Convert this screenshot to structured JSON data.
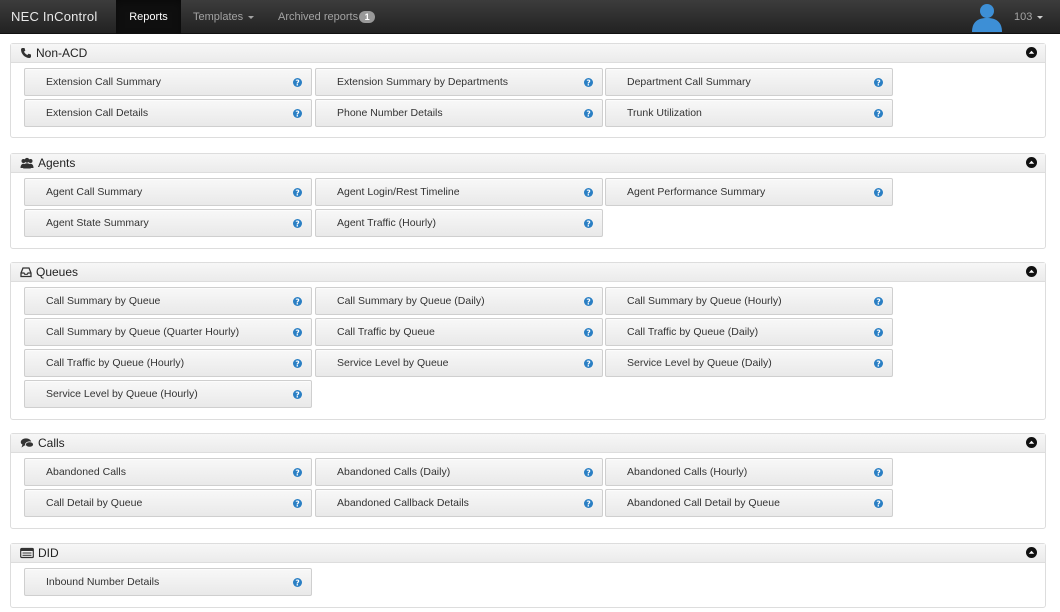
{
  "navbar": {
    "brand": "NEC InControl",
    "reports": "Reports",
    "templates": "Templates",
    "archived": "Archived reports",
    "archived_count": "1",
    "user": "103"
  },
  "sections": {
    "non_acd": {
      "title": "Non-ACD",
      "icon": "phone-icon",
      "items": [
        "Extension Call Summary",
        "Extension Summary by Departments",
        "Department Call Summary",
        "Extension Call Details",
        "Phone Number Details",
        "Trunk Utilization"
      ]
    },
    "agents": {
      "title": "Agents",
      "icon": "users-icon",
      "items": [
        "Agent Call Summary",
        "Agent Login/Rest Timeline",
        "Agent Performance Summary",
        "Agent State Summary",
        "Agent Traffic (Hourly)"
      ]
    },
    "queues": {
      "title": "Queues",
      "icon": "inbox-icon",
      "items": [
        "Call Summary by Queue",
        "Call Summary by Queue (Daily)",
        "Call Summary by Queue (Hourly)",
        "Call Summary by Queue (Quarter Hourly)",
        "Call Traffic by Queue",
        "Call Traffic by Queue (Daily)",
        "Call Traffic by Queue (Hourly)",
        "Service Level by Queue",
        "Service Level by Queue (Daily)",
        "Service Level by Queue (Hourly)"
      ]
    },
    "calls": {
      "title": "Calls",
      "icon": "comments-icon",
      "items": [
        "Abandoned Calls",
        "Abandoned Calls (Daily)",
        "Abandoned Calls (Hourly)",
        "Call Detail by Queue",
        "Abandoned Callback Details",
        "Abandoned Call Detail by Queue"
      ]
    },
    "did": {
      "title": "DID",
      "icon": "list-icon",
      "items": [
        "Inbound Number Details"
      ]
    }
  },
  "colors": {
    "help_icon": "#2a7fc4",
    "navbar": "#2b2b2b",
    "avatar": "#3d8fd6"
  }
}
